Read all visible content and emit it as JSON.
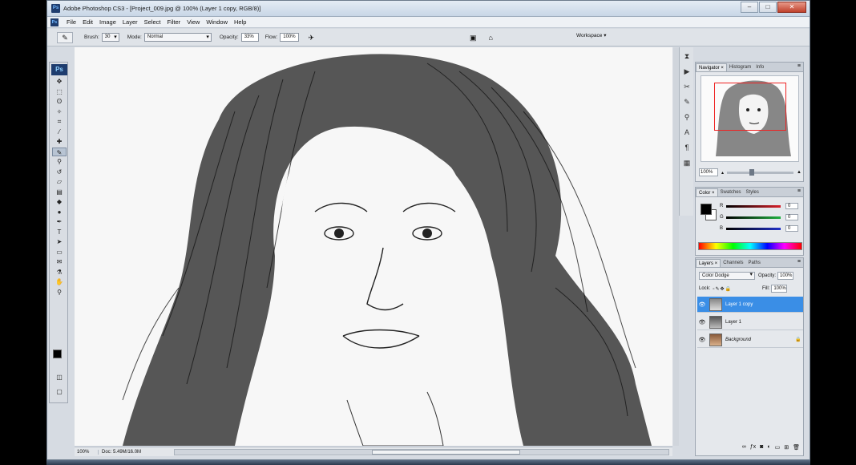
{
  "window": {
    "title": "Adobe Photoshop CS3 - [Project_009.jpg @ 100% (Layer 1 copy, RGB/8)]",
    "app_mark": "Ps",
    "minimize": "–",
    "maximize": "□",
    "close": "✕"
  },
  "menu": [
    "File",
    "Edit",
    "Image",
    "Layer",
    "Select",
    "Filter",
    "View",
    "Window",
    "Help"
  ],
  "options": {
    "tool_icon": "brush-icon",
    "brush_label": "Brush:",
    "brush_size": "30",
    "mode_label": "Mode:",
    "mode_value": "Normal",
    "opacity_label": "Opacity:",
    "opacity_value": "33%",
    "flow_label": "Flow:",
    "flow_value": "100%",
    "workspace_label": "Workspace ▾"
  },
  "tools": [
    "move-tool",
    "marquee-tool",
    "lasso-tool",
    "quick-select-tool",
    "crop-tool",
    "slice-tool",
    "healing-brush-tool",
    "brush-tool",
    "clone-stamp-tool",
    "history-brush-tool",
    "eraser-tool",
    "gradient-tool",
    "blur-tool",
    "dodge-tool",
    "pen-tool",
    "type-tool",
    "path-select-tool",
    "shape-tool",
    "notes-tool",
    "eyedropper-tool",
    "hand-tool",
    "zoom-tool"
  ],
  "status": {
    "zoom": "100%",
    "doc": "Doc: 5.49M/16.0M"
  },
  "navigator": {
    "tabs": [
      "Navigator ×",
      "Histogram",
      "Info"
    ],
    "zoom": "100%"
  },
  "color_panel": {
    "tabs": [
      "Color ×",
      "Swatches",
      "Styles"
    ],
    "channels": [
      {
        "label": "R",
        "value": "0",
        "color": "#d8202a"
      },
      {
        "label": "G",
        "value": "0",
        "color": "#20b040"
      },
      {
        "label": "B",
        "value": "0",
        "color": "#2030c8"
      }
    ]
  },
  "layers_panel": {
    "tabs": [
      "Layers ×",
      "Channels",
      "Paths"
    ],
    "blend_mode": "Color Dodge",
    "opacity_label": "Opacity:",
    "opacity_value": "100%",
    "lock_label": "Lock:",
    "fill_label": "Fill:",
    "fill_value": "100%",
    "layers": [
      {
        "name": "Layer 1 copy",
        "selected": true
      },
      {
        "name": "Layer 1",
        "selected": false
      },
      {
        "name": "Background",
        "selected": false
      }
    ]
  },
  "colors": {
    "selection": "#3a8ee6",
    "nav_frame": "#e22222"
  }
}
